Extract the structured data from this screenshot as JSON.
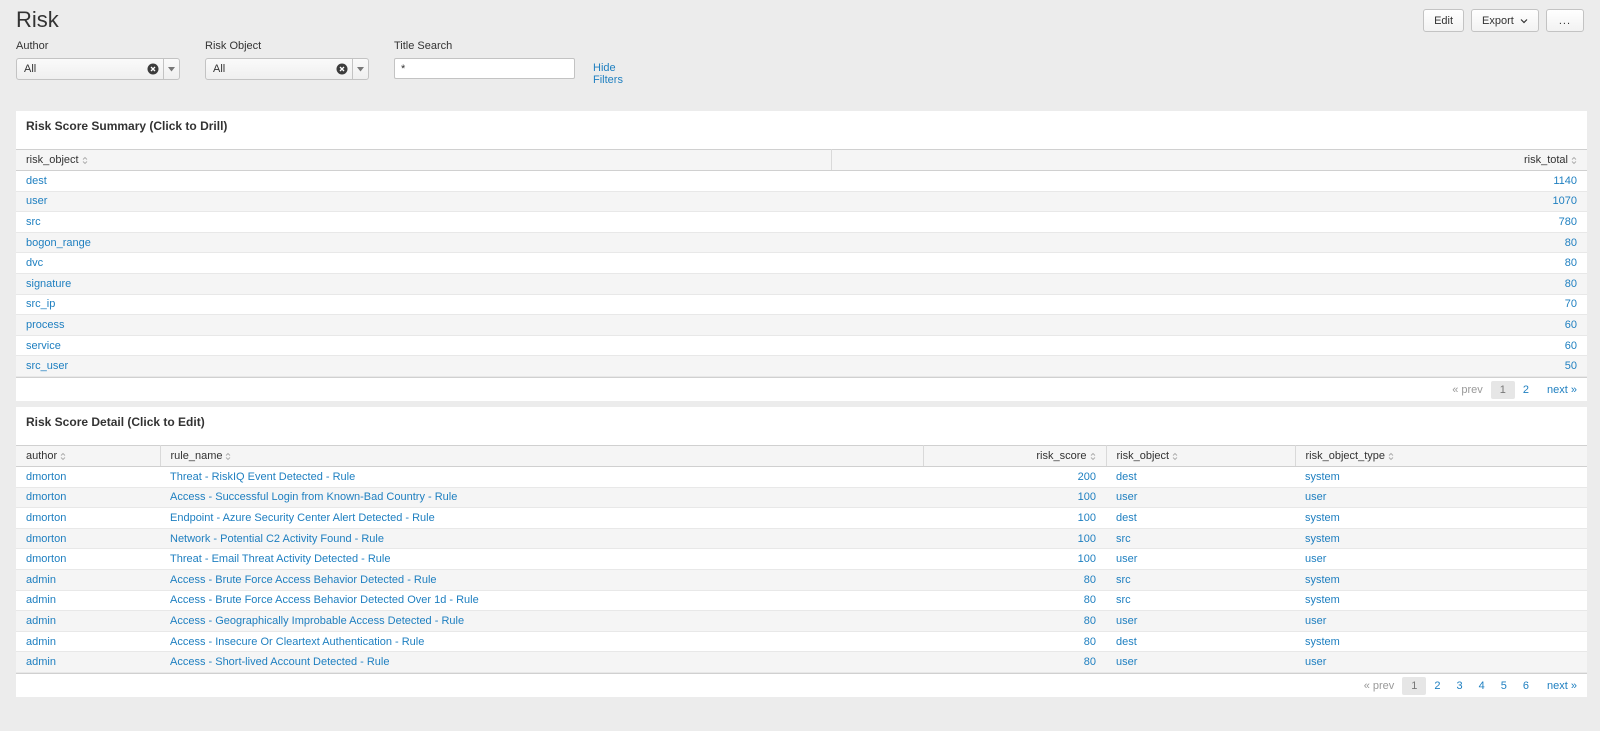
{
  "header": {
    "title": "Risk",
    "edit_label": "Edit",
    "export_label": "Export",
    "more_label": "..."
  },
  "filters": {
    "author": {
      "label": "Author",
      "value": "All"
    },
    "risk_object": {
      "label": "Risk Object",
      "value": "All"
    },
    "title_search": {
      "label": "Title Search",
      "value": "*"
    },
    "hide_filters_label": "Hide Filters"
  },
  "summary": {
    "title": "Risk Score Summary (Click to Drill)",
    "columns": [
      "risk_object",
      "risk_total"
    ],
    "rows": [
      [
        "dest",
        "1140"
      ],
      [
        "user",
        "1070"
      ],
      [
        "src",
        "780"
      ],
      [
        "bogon_range",
        "80"
      ],
      [
        "dvc",
        "80"
      ],
      [
        "signature",
        "80"
      ],
      [
        "src_ip",
        "70"
      ],
      [
        "process",
        "60"
      ],
      [
        "service",
        "60"
      ],
      [
        "src_user",
        "50"
      ]
    ],
    "pager": {
      "prev": "« prev",
      "pages": [
        "1",
        "2"
      ],
      "active": "1",
      "next": "next »"
    }
  },
  "detail": {
    "title": "Risk Score Detail (Click to Edit)",
    "columns": [
      "author",
      "rule_name",
      "risk_score",
      "risk_object",
      "risk_object_type"
    ],
    "rows": [
      [
        "dmorton",
        "Threat - RiskIQ Event Detected - Rule",
        "200",
        "dest",
        "system"
      ],
      [
        "dmorton",
        "Access - Successful Login from Known-Bad Country - Rule",
        "100",
        "user",
        "user"
      ],
      [
        "dmorton",
        "Endpoint - Azure Security Center Alert Detected - Rule",
        "100",
        "dest",
        "system"
      ],
      [
        "dmorton",
        "Network - Potential C2 Activity Found - Rule",
        "100",
        "src",
        "system"
      ],
      [
        "dmorton",
        "Threat - Email Threat Activity Detected - Rule",
        "100",
        "user",
        "user"
      ],
      [
        "admin",
        "Access - Brute Force Access Behavior Detected - Rule",
        "80",
        "src",
        "system"
      ],
      [
        "admin",
        "Access - Brute Force Access Behavior Detected Over 1d - Rule",
        "80",
        "src",
        "system"
      ],
      [
        "admin",
        "Access - Geographically Improbable Access Detected - Rule",
        "80",
        "user",
        "user"
      ],
      [
        "admin",
        "Access - Insecure Or Cleartext Authentication - Rule",
        "80",
        "dest",
        "system"
      ],
      [
        "admin",
        "Access - Short-lived Account Detected - Rule",
        "80",
        "user",
        "user"
      ]
    ],
    "pager": {
      "prev": "« prev",
      "pages": [
        "1",
        "2",
        "3",
        "4",
        "5",
        "6"
      ],
      "active": "1",
      "next": "next »"
    }
  },
  "colors": {
    "link": "#1e7fc0",
    "background": "#ececec",
    "panel": "#ffffff"
  }
}
